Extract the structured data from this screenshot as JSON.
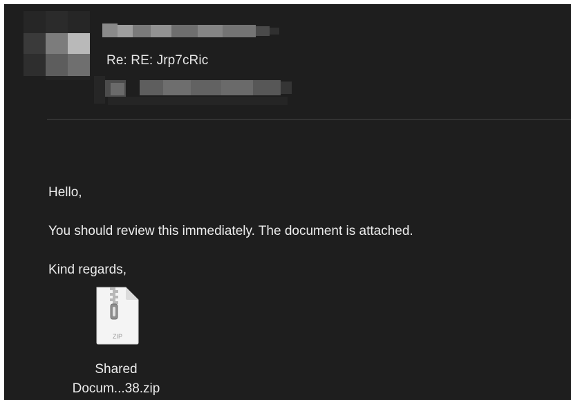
{
  "header": {
    "subject": "Re: RE: Jrp7cRic"
  },
  "message": {
    "greeting": "Hello,",
    "body": "You should review this immediately. The document is attached.",
    "closing": "Kind regards,"
  },
  "attachment": {
    "icon_label": "ZIP",
    "name_line1": "Shared",
    "name_line2": "Docum...38.zip"
  },
  "colors": {
    "background": "#1e1e1e",
    "text": "#ececec",
    "divider": "#444444"
  }
}
